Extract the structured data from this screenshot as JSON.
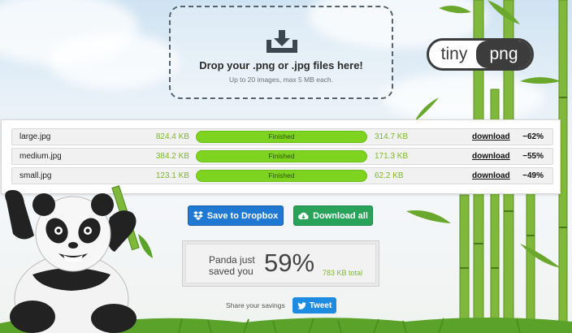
{
  "dropzone": {
    "icon": "download-tray-icon",
    "title": "Drop your .png or .jpg files here!",
    "subtitle": "Up to 20 images, max 5 MB each."
  },
  "logo": {
    "left": "tiny",
    "right": "png"
  },
  "results": [
    {
      "name": "large.jpg",
      "original": "824.4 KB",
      "status": "Finished",
      "progress": 1.0,
      "compressed": "314.7 KB",
      "download": "download",
      "savings": "−62%"
    },
    {
      "name": "medium.jpg",
      "original": "384.2 KB",
      "status": "Finished",
      "progress": 1.0,
      "compressed": "171.3 KB",
      "download": "download",
      "savings": "−55%"
    },
    {
      "name": "small.jpg",
      "original": "123.1 KB",
      "status": "Finished",
      "progress": 1.0,
      "compressed": "62.2 KB",
      "download": "download",
      "savings": "−49%"
    }
  ],
  "actions": {
    "dropbox_label": "Save to Dropbox",
    "dropbox_icon": "dropbox-icon",
    "download_all_label": "Download all",
    "download_all_icon": "cloud-download-icon"
  },
  "savings": {
    "line1": "Panda just",
    "line2": "saved you",
    "percent": "59%",
    "total": "783 KB total"
  },
  "share": {
    "label": "Share your savings",
    "tweet_label": "Tweet",
    "tweet_icon": "twitter-bird-icon"
  },
  "colors": {
    "accent_green": "#7ed321",
    "size_text_green": "#7cb826",
    "dropbox_blue": "#1f78d1",
    "download_green": "#2aa35a",
    "tweet_blue": "#1d8ce0"
  }
}
